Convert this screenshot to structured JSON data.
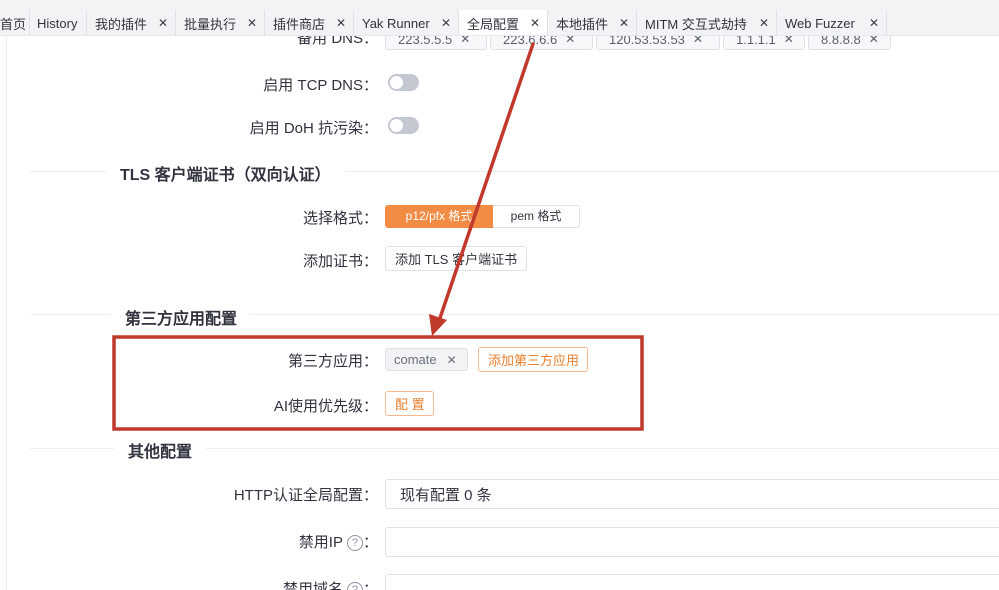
{
  "tabs": [
    {
      "label": "首页",
      "closable": false,
      "active": false
    },
    {
      "label": "History",
      "closable": false,
      "active": false
    },
    {
      "label": "我的插件",
      "closable": true,
      "active": false
    },
    {
      "label": "批量执行",
      "closable": true,
      "active": false
    },
    {
      "label": "插件商店",
      "closable": true,
      "active": false
    },
    {
      "label": "Yak Runner",
      "closable": true,
      "active": false
    },
    {
      "label": "全局配置",
      "closable": true,
      "active": true
    },
    {
      "label": "本地插件",
      "closable": true,
      "active": false
    },
    {
      "label": "MITM 交互式劫持",
      "closable": true,
      "active": false
    },
    {
      "label": "Web Fuzzer",
      "closable": true,
      "active": false
    }
  ],
  "close_glyph": "✕",
  "dns": {
    "label": "备用 DNS：",
    "servers": [
      "223.5.5.5",
      "223.6.6.6",
      "120.53.53.53",
      "1.1.1.1",
      "8.8.8.8"
    ],
    "tcp_dns_label": "启用 TCP DNS：",
    "tcp_dns_enabled": false,
    "doh_label": "启用 DoH 抗污染：",
    "doh_enabled": false
  },
  "tls_section": {
    "title": "TLS 客户端证书（双向认证）",
    "format_label": "选择格式：",
    "format_options": [
      "p12/pfx 格式",
      "pem 格式"
    ],
    "format_selected": "p12/pfx 格式",
    "add_cert_label": "添加证书：",
    "add_cert_button": "添加 TLS 客户端证书"
  },
  "third_party_section": {
    "title": "第三方应用配置",
    "apps_label": "第三方应用：",
    "apps": [
      "comate"
    ],
    "add_app_button": "添加第三方应用",
    "ai_priority_label": "AI使用优先级：",
    "configure_button": "配 置"
  },
  "other_section": {
    "title": "其他配置",
    "http_auth_label": "HTTP认证全局配置：",
    "http_auth_value": "现有配置 0 条",
    "banned_ip_label": "禁用IP",
    "banned_domain_label": "禁用域名",
    "help_glyph": "?",
    "colon": "："
  },
  "colors": {
    "accent": "#F28B44",
    "annotation": "#C0392B",
    "toggle_off": "#C4C8D0"
  }
}
